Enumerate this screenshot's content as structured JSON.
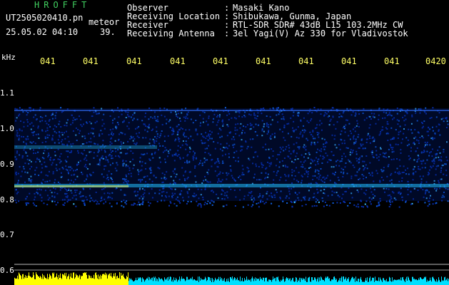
{
  "header": {
    "app_title": "HROFFT",
    "file_name": "UT2505020410.pn",
    "meteor_label": "meteor",
    "datetime": "25.05.02 04:10",
    "meteor_count": "39."
  },
  "info": [
    {
      "key": "Observer",
      "value": "Masaki Kano"
    },
    {
      "key": "Receiving Location",
      "value": "Shibukawa, Gunma, Japan"
    },
    {
      "key": "Receiver",
      "value": "RTL-SDR SDR# 43dB L15 103.2MHz CW"
    },
    {
      "key": "Receiving Antenna",
      "value": "3el Yagi(V) Az 330 for Vladivostok"
    }
  ],
  "separator": ":",
  "y_axis": {
    "unit": "kHz",
    "ticks": [
      "1.1",
      "1.0",
      "0.9",
      "0.8",
      "0.7",
      "0.6"
    ]
  },
  "x_axis": {
    "ticks": [
      "041",
      "041",
      "041",
      "041",
      "041",
      "041",
      "041",
      "041",
      "041",
      "0420"
    ]
  },
  "colors": {
    "background": "#000000",
    "title": "#40d060",
    "text": "#ffffff",
    "time_ticks": "#ffff66",
    "signal_low": "#001a80",
    "signal_high": "#20e0ff",
    "level_bar_left": "#ffff00",
    "level_bar_right": "#00e0ff"
  }
}
